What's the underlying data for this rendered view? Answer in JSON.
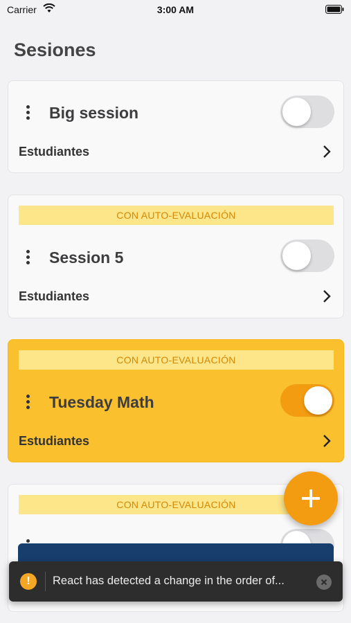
{
  "status_bar": {
    "carrier": "Carrier",
    "time": "3:00 AM"
  },
  "page": {
    "title": "Sesiones"
  },
  "sessions": [
    {
      "name": "Big session",
      "badge": "",
      "enabled": false,
      "students_label": "Estudiantes"
    },
    {
      "name": "Session 5",
      "badge": "CON AUTO-EVALUACIÓN",
      "enabled": false,
      "students_label": "Estudiantes"
    },
    {
      "name": "Tuesday Math",
      "badge": "CON AUTO-EVALUACIÓN",
      "enabled": true,
      "students_label": "Estudiantes"
    },
    {
      "name": "",
      "badge": "CON AUTO-EVALUACIÓN",
      "enabled": false,
      "students_label": ""
    }
  ],
  "fab": {
    "icon": "plus-icon"
  },
  "toast": {
    "icon": "warning-icon",
    "message": "React has detected a change in the order of..."
  },
  "colors": {
    "accent": "#f39c12",
    "active_card": "#fbc02d",
    "badge_bg": "#fde68a",
    "badge_text": "#d48806",
    "toast_bg": "#2d2d2d"
  }
}
